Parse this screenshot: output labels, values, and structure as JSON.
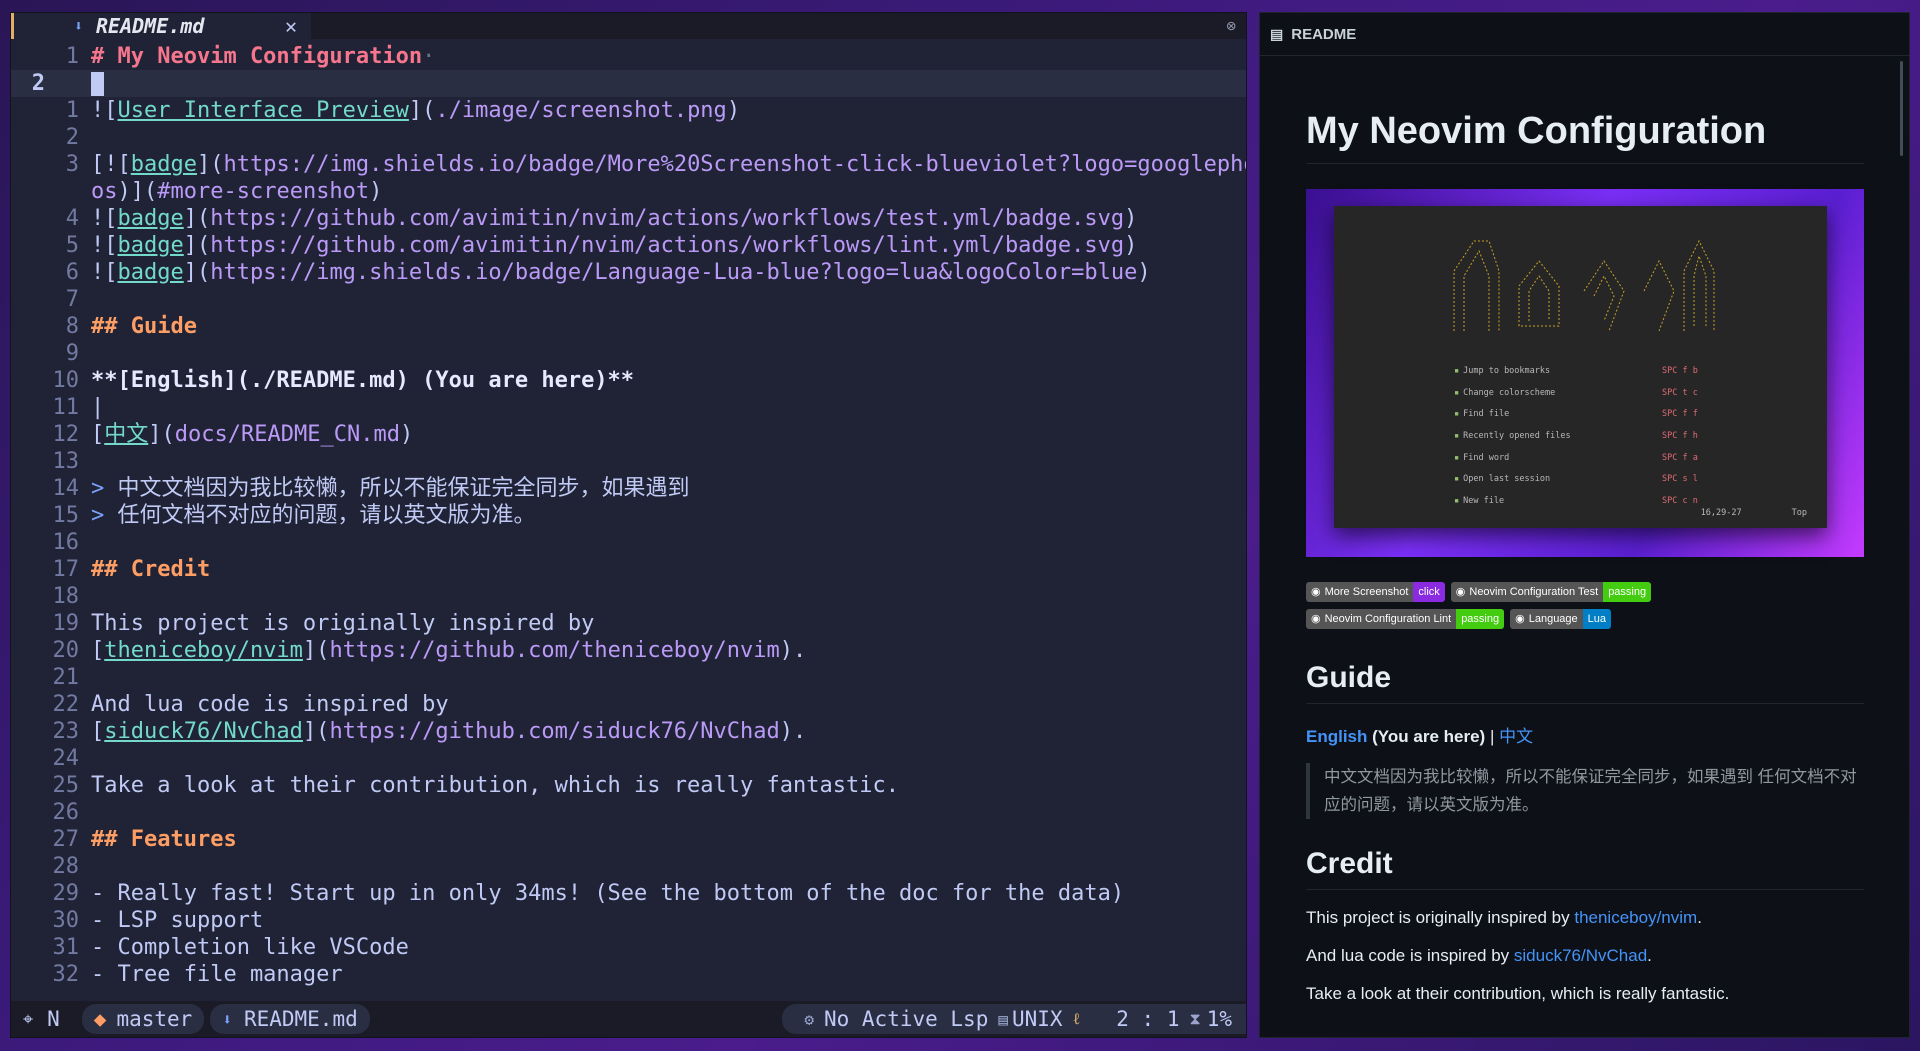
{
  "editor": {
    "tab_filename": "README.md",
    "lines": [
      {
        "num": "1",
        "segments": [
          {
            "c": "h1",
            "t": "# My Neovim Configuration"
          },
          {
            "c": "dim",
            "t": "·"
          }
        ]
      },
      {
        "num": "2",
        "current": true,
        "segments": []
      },
      {
        "num": "1",
        "segments": [
          {
            "c": "br",
            "t": "!["
          },
          {
            "c": "lt",
            "t": "User Interface Preview"
          },
          {
            "c": "br",
            "t": "]("
          },
          {
            "c": "url",
            "t": "./image/screenshot.png"
          },
          {
            "c": "br",
            "t": ")"
          }
        ]
      },
      {
        "num": "2",
        "segments": []
      },
      {
        "num": "3",
        "segments": [
          {
            "c": "br",
            "t": "[!["
          },
          {
            "c": "lt",
            "t": "badge"
          },
          {
            "c": "br",
            "t": "]("
          },
          {
            "c": "url",
            "t": "https://img.shields.io/badge/More%20Screenshot-click-blueviolet?logo=googlephot"
          }
        ]
      },
      {
        "num": "",
        "segments": [
          {
            "c": "url",
            "t": "os"
          },
          {
            "c": "br",
            "t": ")]("
          },
          {
            "c": "url",
            "t": "#more-screenshot"
          },
          {
            "c": "br",
            "t": ")"
          }
        ]
      },
      {
        "num": "4",
        "segments": [
          {
            "c": "br",
            "t": "!["
          },
          {
            "c": "lt",
            "t": "badge"
          },
          {
            "c": "br",
            "t": "]("
          },
          {
            "c": "url",
            "t": "https://github.com/avimitin/nvim/actions/workflows/test.yml/badge.svg"
          },
          {
            "c": "br",
            "t": ")"
          }
        ]
      },
      {
        "num": "5",
        "segments": [
          {
            "c": "br",
            "t": "!["
          },
          {
            "c": "lt",
            "t": "badge"
          },
          {
            "c": "br",
            "t": "]("
          },
          {
            "c": "url",
            "t": "https://github.com/avimitin/nvim/actions/workflows/lint.yml/badge.svg"
          },
          {
            "c": "br",
            "t": ")"
          }
        ]
      },
      {
        "num": "6",
        "segments": [
          {
            "c": "br",
            "t": "!["
          },
          {
            "c": "lt",
            "t": "badge"
          },
          {
            "c": "br",
            "t": "]("
          },
          {
            "c": "url",
            "t": "https://img.shields.io/badge/Language-Lua-blue?logo=lua&logoColor=blue"
          },
          {
            "c": "br",
            "t": ")"
          }
        ]
      },
      {
        "num": "7",
        "segments": []
      },
      {
        "num": "8",
        "segments": [
          {
            "c": "h",
            "t": "## Guide"
          }
        ]
      },
      {
        "num": "9",
        "segments": []
      },
      {
        "num": "10",
        "segments": [
          {
            "c": "bold",
            "t": "**[English](./README.md) (You are here)**"
          }
        ]
      },
      {
        "num": "11",
        "segments": [
          {
            "c": "br",
            "t": "|"
          }
        ]
      },
      {
        "num": "12",
        "segments": [
          {
            "c": "br",
            "t": "["
          },
          {
            "c": "lt",
            "t": "中文"
          },
          {
            "c": "br",
            "t": "]("
          },
          {
            "c": "url",
            "t": "docs/README_CN.md"
          },
          {
            "c": "br",
            "t": ")"
          }
        ]
      },
      {
        "num": "13",
        "segments": []
      },
      {
        "num": "14",
        "segments": [
          {
            "c": "q",
            "t": "> "
          },
          {
            "c": "br",
            "t": "中文文档因为我比较懒，所以不能保证完全同步，如果遇到"
          }
        ]
      },
      {
        "num": "15",
        "segments": [
          {
            "c": "q",
            "t": "> "
          },
          {
            "c": "br",
            "t": "任何文档不对应的问题，请以英文版为准。"
          }
        ]
      },
      {
        "num": "16",
        "segments": []
      },
      {
        "num": "17",
        "segments": [
          {
            "c": "h",
            "t": "## Credit"
          }
        ]
      },
      {
        "num": "18",
        "segments": []
      },
      {
        "num": "19",
        "segments": [
          {
            "c": "br",
            "t": "This project is originally inspired by"
          }
        ]
      },
      {
        "num": "20",
        "segments": [
          {
            "c": "br",
            "t": "["
          },
          {
            "c": "lt",
            "t": "theniceboy/nvim"
          },
          {
            "c": "br",
            "t": "]("
          },
          {
            "c": "url",
            "t": "https://github.com/theniceboy/nvim"
          },
          {
            "c": "br",
            "t": ")."
          }
        ]
      },
      {
        "num": "21",
        "segments": []
      },
      {
        "num": "22",
        "segments": [
          {
            "c": "br",
            "t": "And lua code is inspired by"
          }
        ]
      },
      {
        "num": "23",
        "segments": [
          {
            "c": "br",
            "t": "["
          },
          {
            "c": "lt",
            "t": "siduck76/NvChad"
          },
          {
            "c": "br",
            "t": "]("
          },
          {
            "c": "url",
            "t": "https://github.com/siduck76/NvChad"
          },
          {
            "c": "br",
            "t": ")."
          }
        ]
      },
      {
        "num": "24",
        "segments": []
      },
      {
        "num": "25",
        "segments": [
          {
            "c": "br",
            "t": "Take a look at their contribution, which is really fantastic."
          }
        ]
      },
      {
        "num": "26",
        "segments": []
      },
      {
        "num": "27",
        "segments": [
          {
            "c": "h",
            "t": "## Features"
          }
        ]
      },
      {
        "num": "28",
        "segments": []
      },
      {
        "num": "29",
        "segments": [
          {
            "c": "br",
            "t": "- Really fast! Start up in only 34ms! (See the bottom of the doc for the data)"
          }
        ]
      },
      {
        "num": "30",
        "segments": [
          {
            "c": "br",
            "t": "- LSP support"
          }
        ]
      },
      {
        "num": "31",
        "segments": [
          {
            "c": "br",
            "t": "- Completion like VSCode"
          }
        ]
      },
      {
        "num": "32",
        "segments": [
          {
            "c": "br",
            "t": "- Tree file manager"
          }
        ]
      }
    ]
  },
  "statusline": {
    "mode": "N",
    "branch": "master",
    "file": "README.md",
    "lsp": "No Active Lsp",
    "format": "UNIX",
    "position": "2 : 1",
    "percent": "1%"
  },
  "preview": {
    "header": "README",
    "title": "My Neovim Configuration",
    "shot_menu": [
      {
        "label": "Jump to bookmarks",
        "key": "SPC f b"
      },
      {
        "label": "Change colorscheme",
        "key": "SPC t c"
      },
      {
        "label": "Find file",
        "key": "SPC f f"
      },
      {
        "label": "Recently opened files",
        "key": "SPC f h"
      },
      {
        "label": "Find word",
        "key": "SPC f a"
      },
      {
        "label": "Open last session",
        "key": "SPC s l"
      },
      {
        "label": "New file",
        "key": "SPC c n"
      }
    ],
    "shot_footer": {
      "pos": "16,29-27",
      "where": "Top"
    },
    "badges": [
      {
        "left": "More Screenshot",
        "right": "click",
        "color": "#8a2be2"
      },
      {
        "left": "Neovim Configuration Test",
        "right": "passing",
        "color": "#4c1"
      },
      {
        "left": "Neovim Configuration Lint",
        "right": "passing",
        "color": "#4c1"
      },
      {
        "left": "Language",
        "right": "Lua",
        "color": "#007ec6"
      }
    ],
    "guide_heading": "Guide",
    "guide_english": "English",
    "guide_here": "(You are here)",
    "guide_sep": "|",
    "guide_cn": "中文",
    "guide_quote": "中文文档因为我比较懒，所以不能保证完全同步，如果遇到 任何文档不对应的问题，请以英文版为准。",
    "credit_heading": "Credit",
    "credit_p1_pre": "This project is originally inspired by ",
    "credit_p1_link": "theniceboy/nvim",
    "credit_p1_post": ".",
    "credit_p2_pre": "And lua code is inspired by ",
    "credit_p2_link": "siduck76/NvChad",
    "credit_p2_post": ".",
    "credit_p3": "Take a look at their contribution, which is really fantastic."
  }
}
